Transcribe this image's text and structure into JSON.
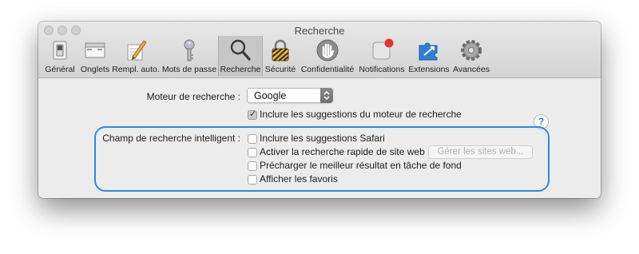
{
  "window": {
    "title": "Recherche"
  },
  "toolbar": {
    "items": [
      {
        "label": "Général",
        "icon": "general-switch-icon"
      },
      {
        "label": "Onglets",
        "icon": "tabs-icon"
      },
      {
        "label": "Rempl. auto.",
        "icon": "autofill-pencil-icon"
      },
      {
        "label": "Mots de passe",
        "icon": "key-icon"
      },
      {
        "label": "Recherche",
        "icon": "magnifier-icon",
        "selected": true
      },
      {
        "label": "Sécurité",
        "icon": "padlock-icon"
      },
      {
        "label": "Confidentialité",
        "icon": "hand-icon"
      },
      {
        "label": "Notifications",
        "icon": "notification-icon"
      },
      {
        "label": "Extensions",
        "icon": "puzzle-icon"
      },
      {
        "label": "Avancées",
        "icon": "gear-icon"
      }
    ]
  },
  "search": {
    "engine_label": "Moteur de recherche :",
    "engine_value": "Google",
    "include_suggestions_label": "Inclure les suggestions du moteur de recherche",
    "include_suggestions_checked": true
  },
  "smart_field": {
    "label": "Champ de recherche intelligent :",
    "options": [
      {
        "label": "Inclure les suggestions Safari",
        "checked": false
      },
      {
        "label": "Activer la recherche rapide de site web",
        "checked": false
      },
      {
        "label": "Précharger le meilleur résultat en tâche de fond",
        "checked": false
      },
      {
        "label": "Afficher les favoris",
        "checked": false
      }
    ],
    "manage_sites_label": "Gérer les sites web..."
  },
  "help": {
    "glyph": "?"
  },
  "colors": {
    "highlight": "#2b8be0",
    "selected_tab": "#c6c6c6"
  }
}
